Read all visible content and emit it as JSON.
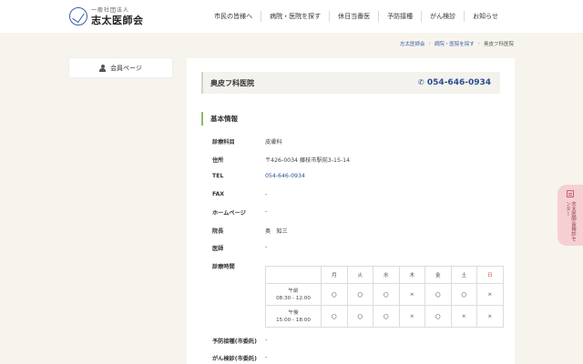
{
  "header": {
    "logo_sub": "一般社団法人",
    "logo_main": "志太医師会",
    "nav": [
      "市民の皆様へ",
      "病院・医院を探す",
      "休日当番医",
      "予防接種",
      "がん検診",
      "お知らせ"
    ]
  },
  "breadcrumb": [
    "志太医師会",
    "病院・医院を探す",
    "奥皮フ科医院"
  ],
  "sidebar": {
    "member_label": "会員ページ"
  },
  "clinic": {
    "name": "奥皮フ科医院",
    "tel": "054-646-0934"
  },
  "section_title": "基本情報",
  "info": [
    {
      "label": "診療科目",
      "value": "皮膚科"
    },
    {
      "label": "住所",
      "value": "〒426-0034 藤枝市駅前3-15-14"
    },
    {
      "label": "TEL",
      "value": "054-646-0934"
    },
    {
      "label": "FAX",
      "value": "-"
    },
    {
      "label": "ホームページ",
      "value": "-"
    },
    {
      "label": "院長",
      "value": "奥　知三"
    },
    {
      "label": "医師",
      "value": "-"
    },
    {
      "label": "診療時間",
      "value": ""
    },
    {
      "label": "予防接種(市委託)",
      "value": "-"
    },
    {
      "label": "がん検診(市委託)",
      "value": "-"
    }
  ],
  "schedule": {
    "days": [
      "月",
      "火",
      "水",
      "木",
      "金",
      "土",
      "日"
    ],
    "rows": [
      {
        "label_top": "午前",
        "label_bottom": "08:30 - 12:00",
        "cells": [
          "〇",
          "〇",
          "〇",
          "×",
          "〇",
          "〇",
          "×"
        ]
      },
      {
        "label_top": "午後",
        "label_bottom": "15:00 - 18:00",
        "cells": [
          "〇",
          "〇",
          "〇",
          "×",
          "〇",
          "×",
          "×"
        ]
      }
    ]
  },
  "side_tab": {
    "label": "志太医師会検診センター"
  },
  "colors": {
    "accent_blue": "#2a4f8f",
    "accent_green": "#8fb86a",
    "side_tab_pink": "#f6cfd3"
  }
}
